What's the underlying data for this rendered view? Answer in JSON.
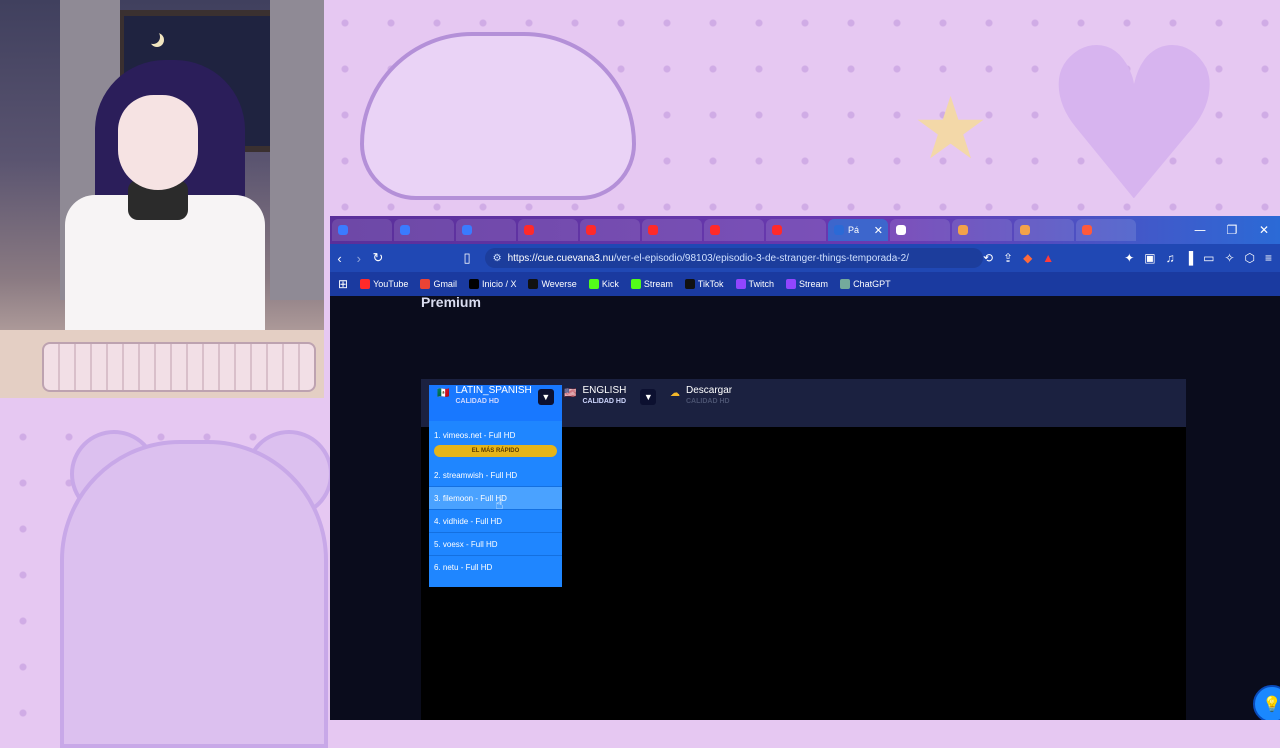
{
  "browser": {
    "tabs": [
      {
        "label": "",
        "color": "#3a7bff"
      },
      {
        "label": "",
        "color": "#3a7bff"
      },
      {
        "label": "",
        "color": "#3a7bff"
      },
      {
        "label": "",
        "color": "#ff2a2a"
      },
      {
        "label": "",
        "color": "#ff2a2a"
      },
      {
        "label": "",
        "color": "#ff2a2a"
      },
      {
        "label": "",
        "color": "#ff2a2a"
      },
      {
        "label": "",
        "color": "#ff2a2a"
      },
      {
        "label": "Pá",
        "color": "#2b6ad6",
        "active": true
      },
      {
        "label": "",
        "color": "#ffffff"
      },
      {
        "label": "",
        "color": "#f2a24a"
      },
      {
        "label": "",
        "color": "#f2a24a"
      },
      {
        "label": "",
        "color": "#ff5a3a"
      }
    ],
    "url_domain": "https://cue.cuevana3.nu",
    "url_path": "/ver-el-episodio/98103/episodio-3-de-stranger-things-temporada-2/",
    "bookmarks": [
      {
        "label": "YouTube",
        "color": "#ff2a2a"
      },
      {
        "label": "Gmail",
        "color": "#ea4335"
      },
      {
        "label": "Inicio / X",
        "color": "#000000"
      },
      {
        "label": "Weverse",
        "color": "#111111"
      },
      {
        "label": "Kick",
        "color": "#53fc18"
      },
      {
        "label": "Stream",
        "color": "#53fc18"
      },
      {
        "label": "TikTok",
        "color": "#111111"
      },
      {
        "label": "Twitch",
        "color": "#9146ff"
      },
      {
        "label": "Stream",
        "color": "#9146ff"
      },
      {
        "label": "ChatGPT",
        "color": "#74aa9c"
      }
    ]
  },
  "page": {
    "premium": "Premium",
    "languages": [
      {
        "flag": "🇲🇽",
        "name": "LATIN_SPANISH",
        "quality": "CALIDAD HD"
      },
      {
        "flag": "🇺🇸",
        "name": "ENGLISH",
        "quality": "CALIDAD HD"
      },
      {
        "flag": "☁",
        "name": "Descargar",
        "quality": "CALIDAD HD"
      }
    ],
    "servers": [
      "1. vimeos.net - Full HD",
      "2. streamwish - Full HD",
      "3. filemoon - Full HD",
      "4. vidhide - Full HD",
      "5. voesx - Full HD",
      "6. netu - Full HD"
    ],
    "fastest_badge": "EL MÁS RÁPIDO"
  }
}
